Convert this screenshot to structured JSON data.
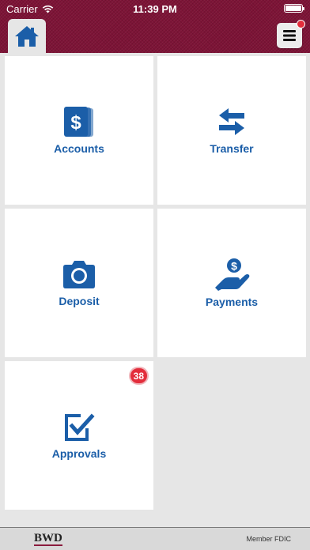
{
  "status_bar": {
    "carrier": "Carrier",
    "time": "11:39 PM"
  },
  "nav": {
    "home_icon": "home-icon",
    "menu_icon": "menu-icon"
  },
  "colors": {
    "brand": "#7d1336",
    "accent_blue": "#1b5ea8",
    "badge_red": "#e32d3b",
    "background": "#e6e6e6"
  },
  "tiles": [
    {
      "label": "Accounts",
      "icon": "dollar-cards-icon"
    },
    {
      "label": "Transfer",
      "icon": "transfer-arrows-icon"
    },
    {
      "label": "Deposit",
      "icon": "camera-icon"
    },
    {
      "label": "Payments",
      "icon": "hand-coin-icon"
    },
    {
      "label": "Approvals",
      "icon": "checkbox-edit-icon",
      "badge": "38"
    }
  ],
  "footer": {
    "logo": "BWD",
    "fdic": "Member FDIC"
  }
}
